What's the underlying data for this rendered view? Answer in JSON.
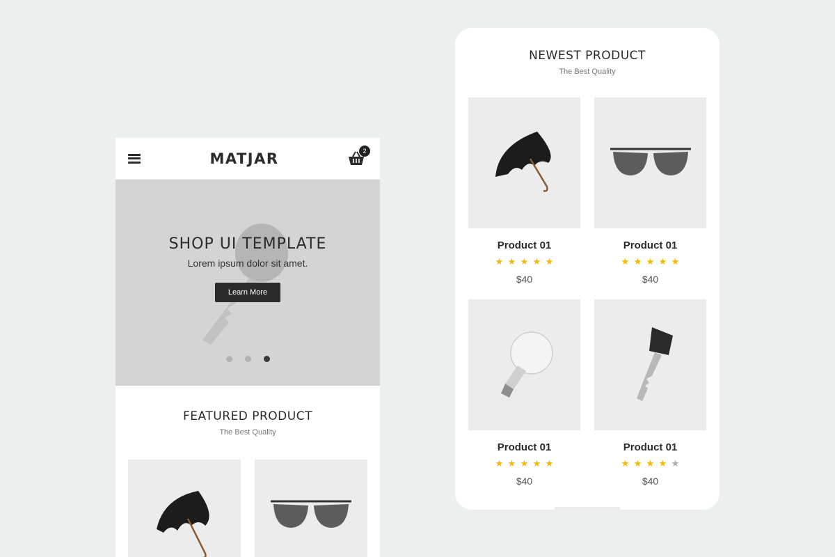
{
  "featured_screen": {
    "brand": "MATJAR",
    "cart_count": "2",
    "hero": {
      "title": "SHOP UI TEMPLATE",
      "subtitle": "Lorem ipsum dolor sit amet.",
      "button_label": "Learn More",
      "slides": 3,
      "active_slide": 3
    },
    "section": {
      "title": "FEATURED PRODUCT",
      "subtitle": "The Best Quality"
    },
    "products": [
      {
        "image": "umbrella-image"
      },
      {
        "image": "sunglasses-image"
      }
    ]
  },
  "newest_screen": {
    "section": {
      "title": "NEWEST PRODUCT",
      "subtitle": "The Best Quality"
    },
    "products": [
      {
        "name": "Product 01",
        "price": "$40",
        "rating": 5,
        "image": "umbrella-image"
      },
      {
        "name": "Product 01",
        "price": "$40",
        "rating": 5,
        "image": "sunglasses-image"
      },
      {
        "name": "Product 01",
        "price": "$40",
        "rating": 5,
        "image": "lightbulb-image"
      },
      {
        "name": "Product 01",
        "price": "$40",
        "rating": 4,
        "image": "key-image"
      }
    ]
  },
  "colors": {
    "background": "#ecefef",
    "star_active": "#f5b800",
    "star_inactive": "#aaaaaa",
    "button": "#2b2b2b",
    "card": "#ececec"
  }
}
